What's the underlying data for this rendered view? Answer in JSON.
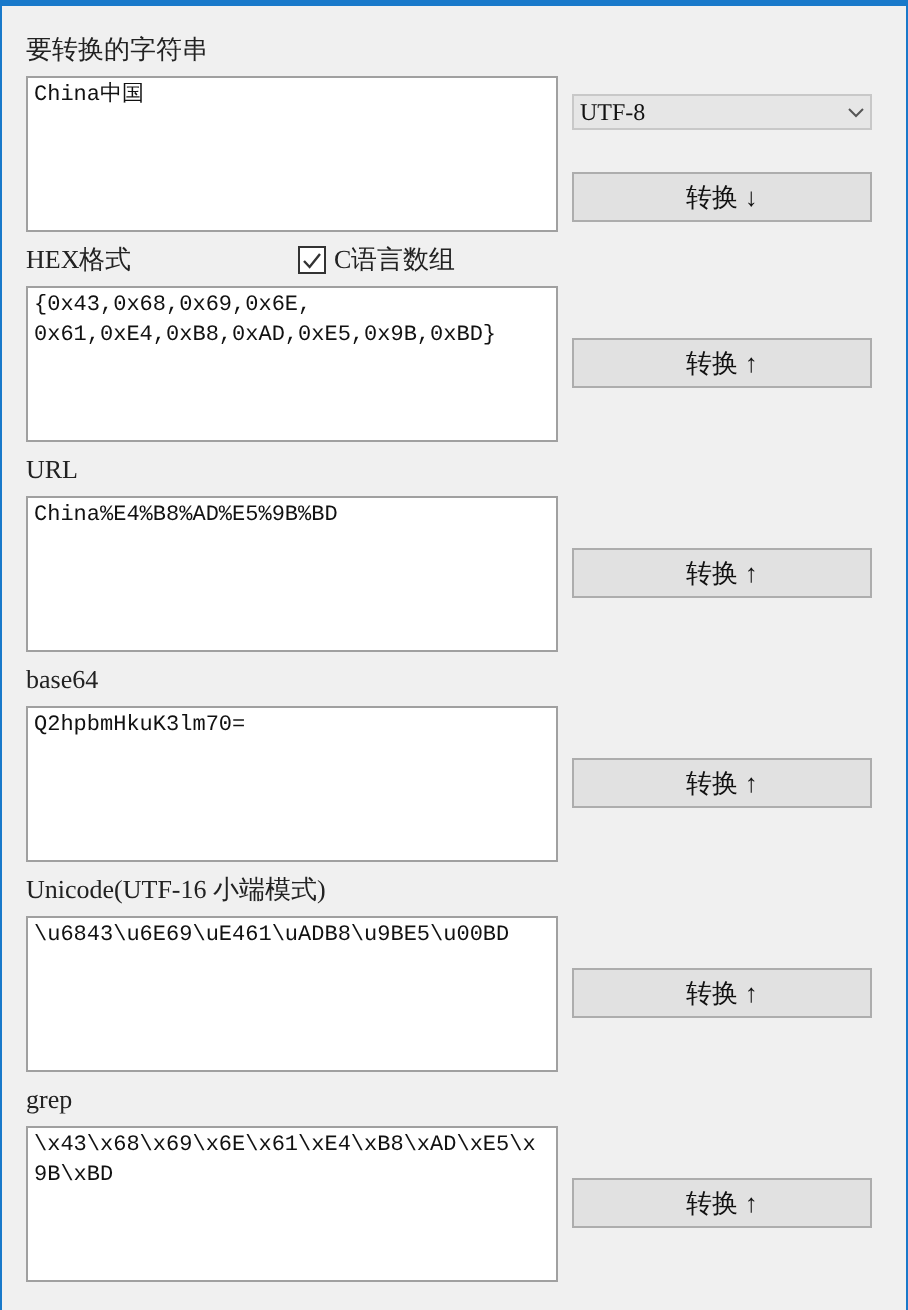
{
  "sections": [
    {
      "label": "要转换的字符串",
      "lines": [
        "China中国"
      ],
      "button": "转换 ↓",
      "encoding": {
        "value": "UTF-8"
      }
    },
    {
      "label": "HEX格式",
      "lines": [
        "{0x43,0x68,0x69,0x6E,",
        "0x61,0xE4,0xB8,0xAD,0xE5,0x9B,0xBD}"
      ],
      "button": "转换 ↑",
      "checkbox": {
        "label": "C语言数组",
        "checked": true
      }
    },
    {
      "label": "URL",
      "lines": [
        "China%E4%B8%AD%E5%9B%BD"
      ],
      "button": "转换 ↑"
    },
    {
      "label": "base64",
      "lines": [
        "Q2hpbmHkuK3lm70="
      ],
      "button": "转换 ↑"
    },
    {
      "label": "Unicode(UTF-16 小端模式)",
      "lines": [
        "\\u6843\\u6E69\\uE461\\uADB8\\u9BE5\\u00BD"
      ],
      "button": "转换 ↑"
    },
    {
      "label": "grep",
      "lines": [
        "\\x43\\x68\\x69\\x6E\\x61\\xE4\\xB8\\xAD\\xE5\\x",
        "9B\\xBD"
      ],
      "button": "转换 ↑"
    }
  ]
}
